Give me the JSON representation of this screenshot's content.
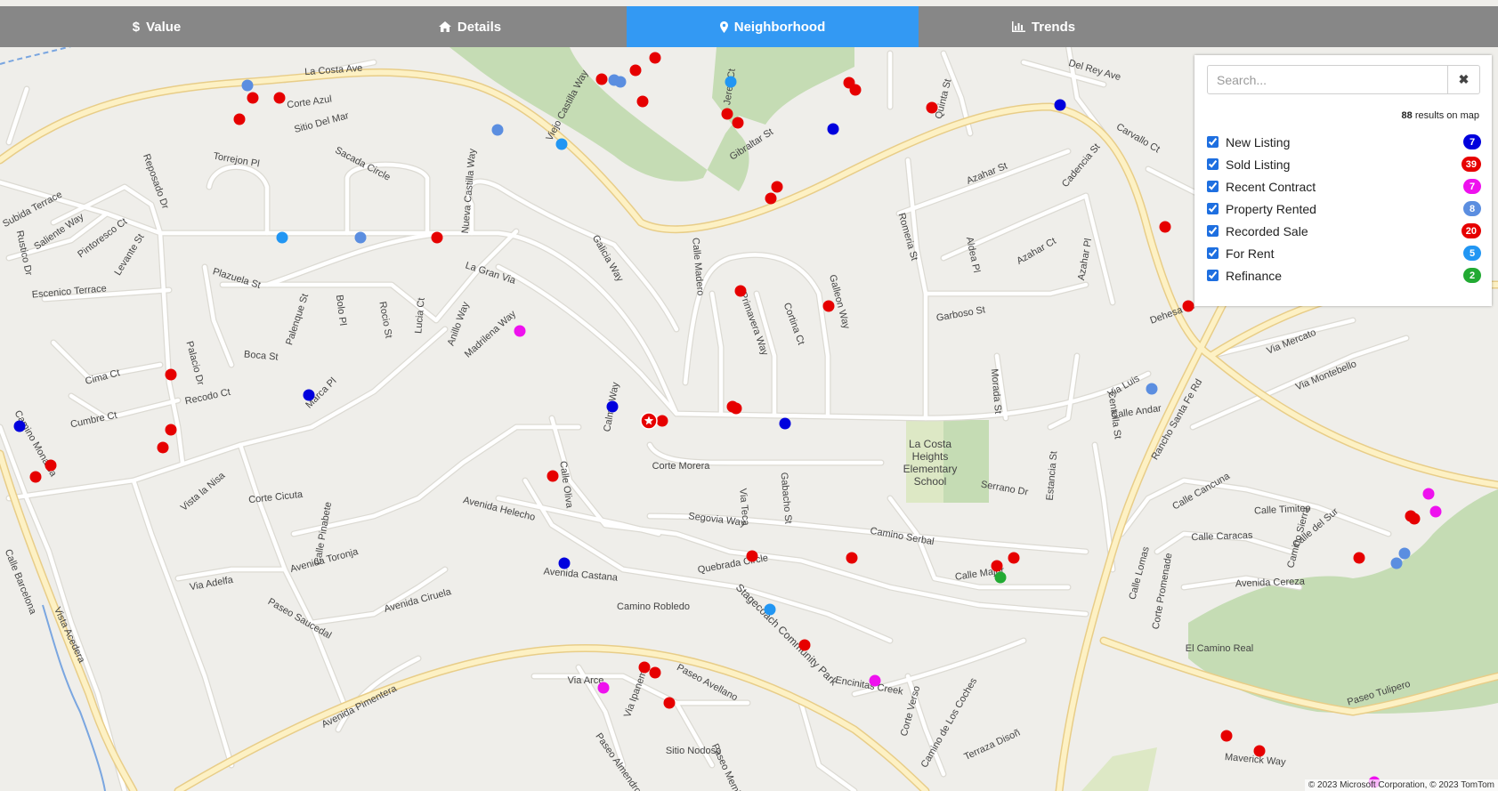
{
  "tabs": [
    {
      "label": "Value",
      "icon": "dollar-icon",
      "active": false
    },
    {
      "label": "Details",
      "icon": "home-icon",
      "active": false
    },
    {
      "label": "Neighborhood",
      "icon": "map-marker-icon",
      "active": true
    },
    {
      "label": "Trends",
      "icon": "bar-chart-icon",
      "active": false
    }
  ],
  "search": {
    "placeholder": "Search...",
    "value": "",
    "clear_label": "✖"
  },
  "results": {
    "count": "88",
    "text": "results on map"
  },
  "legend": [
    {
      "label": "New Listing",
      "count": "7",
      "color": "#0000dd",
      "checked": true
    },
    {
      "label": "Sold Listing",
      "count": "39",
      "color": "#e60000",
      "checked": true
    },
    {
      "label": "Recent Contract",
      "count": "7",
      "color": "#ee11ee",
      "checked": true
    },
    {
      "label": "Property Rented",
      "count": "8",
      "color": "#5b8ee0",
      "checked": true
    },
    {
      "label": "Recorded Sale",
      "count": "20",
      "color": "#e60000",
      "checked": true
    },
    {
      "label": "For Rent",
      "count": "5",
      "color": "#2196f3",
      "checked": true
    },
    {
      "label": "Refinance",
      "count": "2",
      "color": "#22aa33",
      "checked": true
    }
  ],
  "map": {
    "colors": {
      "background": "#efeeea",
      "street": "#ffffff",
      "street_casing": "#dcdad3",
      "arterial": "#fdf1c4",
      "arterial_casing": "#e8cd88",
      "park": "#c5dcb4",
      "school": "#dde8c5",
      "label": "#444444"
    },
    "street_labels": [
      "La Costa Ave",
      "Corte Azul",
      "Sitio Del Mar",
      "Viejo Castilla Way",
      "Jerez Ct",
      "Gibraltar St",
      "Del Rey Ave",
      "Quinta St",
      "Carvallo Ct",
      "Torrejon Pl",
      "Sacada Circle",
      "Nueva Castilla Way",
      "Subida Terrace",
      "Saliente Way",
      "Reposado Dr",
      "Pintoresco Ct",
      "Rustico Dr",
      "Levante St",
      "Escenico Terrace",
      "Galicia Way",
      "Calle Madero",
      "Romeria St",
      "Azahar St",
      "Cadencia St",
      "Aldea Pl",
      "Azahar Ct",
      "Azahar Pl",
      "Plazuela St",
      "Palenque St",
      "Bolo Pl",
      "Rocio St",
      "Lucia Ct",
      "Anillo Way",
      "La Gran Via",
      "Madrilena Way",
      "Primavera Way",
      "Cortina Ct",
      "Galleon Way",
      "Garboso St",
      "Boca St",
      "Palacio Dr",
      "Cima Ct",
      "Recodo Ct",
      "Marca Pl",
      "Cumbre Ct",
      "Calma Way",
      "Morada St",
      "Centella St",
      "Via Luis",
      "Calle Andar",
      "Dehesa Ct",
      "Via Mercato",
      "Via Montebello",
      "Rancho Santa Fe Rd",
      "Corte Morera",
      "Via Teca",
      "Gabacho St",
      "Estancia St",
      "Serrano Dr",
      "Camino Monarca",
      "Vista la Nisa",
      "Corte Cicuta",
      "Calle Pinabete",
      "Avenida Helecho",
      "Calle Oliva",
      "Segovia Way",
      "Camino Serbal",
      "Quebrada Circle",
      "Calle Major",
      "Calle Lomas",
      "Corte Promenade",
      "Calle Cancuna",
      "Calle Timiteo",
      "Calle Caracas",
      "Camino Sierra",
      "Calle del Sur",
      "Avenida Cereza",
      "Avenida Castana",
      "Camino Robledo",
      "Avenida Toronja",
      "Via Adelfa",
      "Paseo Saucedal",
      "Avenida Ciruela",
      "Stagecoach Community Park",
      "Encinitas Creek",
      "El Camino Real",
      "Calle Barcelona",
      "Vista Acedera",
      "Paseo Avellano",
      "Avenida Pimentera",
      "Via Arce",
      "Via Ipanema",
      "Sitio Nodoso",
      "Paseo Almendro",
      "Paseo Membrillo",
      "Corte Verso",
      "Camino de Los Coches",
      "Terraza Disoñ",
      "Maverick Way",
      "Paseo Tulipero"
    ],
    "school_label": [
      "La Costa",
      "Heights",
      "Elementary",
      "School"
    ],
    "copyright": "© 2023 Microsoft Corporation, © 2023 TomTom"
  },
  "markers": {
    "new": [
      [
        22,
        479
      ],
      [
        347,
        444
      ],
      [
        634,
        633
      ],
      [
        688,
        457
      ],
      [
        1191,
        118
      ],
      [
        936,
        145
      ],
      [
        882,
        476
      ]
    ],
    "sold": [
      [
        269,
        134
      ],
      [
        284,
        110
      ],
      [
        314,
        110
      ],
      [
        192,
        421
      ],
      [
        192,
        483
      ],
      [
        183,
        503
      ],
      [
        57,
        523
      ],
      [
        40,
        536
      ],
      [
        491,
        267
      ],
      [
        621,
        535
      ],
      [
        736,
        65
      ],
      [
        714,
        79
      ],
      [
        676,
        89
      ],
      [
        722,
        114
      ],
      [
        744,
        473
      ],
      [
        817,
        128
      ],
      [
        829,
        138
      ],
      [
        954,
        93
      ],
      [
        961,
        101
      ],
      [
        873,
        210
      ],
      [
        866,
        223
      ],
      [
        832,
        327
      ],
      [
        931,
        344
      ],
      [
        823,
        457
      ],
      [
        827,
        459
      ],
      [
        1047,
        121
      ],
      [
        1309,
        255
      ],
      [
        1335,
        344
      ],
      [
        957,
        627
      ],
      [
        1139,
        627
      ],
      [
        1120,
        636
      ],
      [
        1585,
        580
      ],
      [
        1589,
        583
      ],
      [
        1527,
        627
      ],
      [
        845,
        625
      ],
      [
        904,
        725
      ],
      [
        724,
        750
      ],
      [
        736,
        756
      ],
      [
        752,
        790
      ],
      [
        1378,
        827
      ],
      [
        1415,
        844
      ]
    ],
    "contract": [
      [
        584,
        372
      ],
      [
        1605,
        555
      ],
      [
        1613,
        575
      ],
      [
        983,
        765
      ],
      [
        678,
        773
      ],
      [
        1544,
        879
      ]
    ],
    "rented": [
      [
        278,
        96
      ],
      [
        690,
        90
      ],
      [
        697,
        92
      ],
      [
        559,
        146
      ],
      [
        405,
        267
      ],
      [
        1294,
        437
      ],
      [
        1578,
        622
      ],
      [
        1569,
        633
      ]
    ],
    "forrent": [
      [
        821,
        92
      ],
      [
        631,
        162
      ],
      [
        317,
        267
      ],
      [
        865,
        685
      ]
    ],
    "refi": [
      [
        1124,
        649
      ]
    ],
    "subject": [
      729,
      473
    ]
  }
}
